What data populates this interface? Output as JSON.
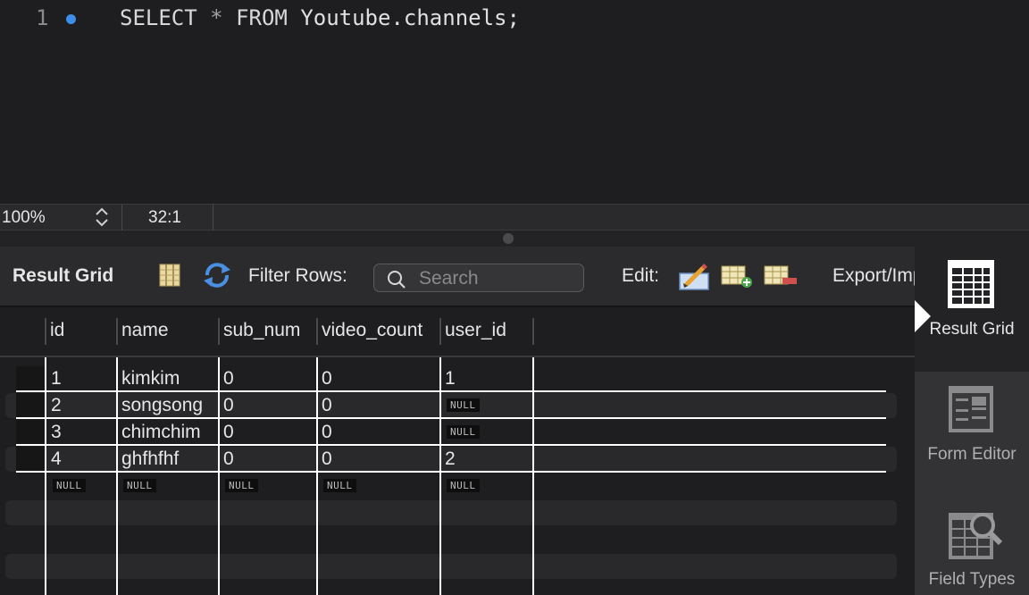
{
  "editor": {
    "line_number": "1",
    "query": {
      "select": "SELECT",
      "star": "*",
      "from": "FROM",
      "table": "Youtube.channels;"
    }
  },
  "status": {
    "zoom": "100%",
    "cursor": "32:1"
  },
  "toolbar": {
    "title": "Result Grid",
    "filter_label": "Filter Rows:",
    "search_placeholder": "Search",
    "edit_label": "Edit:",
    "export_label": "Export/Import:"
  },
  "grid": {
    "columns": [
      "id",
      "name",
      "sub_num",
      "video_count",
      "user_id"
    ],
    "rows": [
      [
        "1",
        "kimkim",
        "0",
        "0",
        "1"
      ],
      [
        "2",
        "songsong",
        "0",
        "0",
        "NULL"
      ],
      [
        "3",
        "chimchim",
        "0",
        "0",
        "NULL"
      ],
      [
        "4",
        "ghfhfhf",
        "0",
        "0",
        "2"
      ],
      [
        "NULL",
        "NULL",
        "NULL",
        "NULL",
        "NULL"
      ]
    ]
  },
  "side_panel": {
    "result_grid": "Result Grid",
    "form_editor": "Form Editor",
    "field_types": "Field Types"
  },
  "colors": {
    "accent": "#3d8ee8",
    "background": "#1e1e20",
    "toolbar": "#2b2b2d"
  }
}
